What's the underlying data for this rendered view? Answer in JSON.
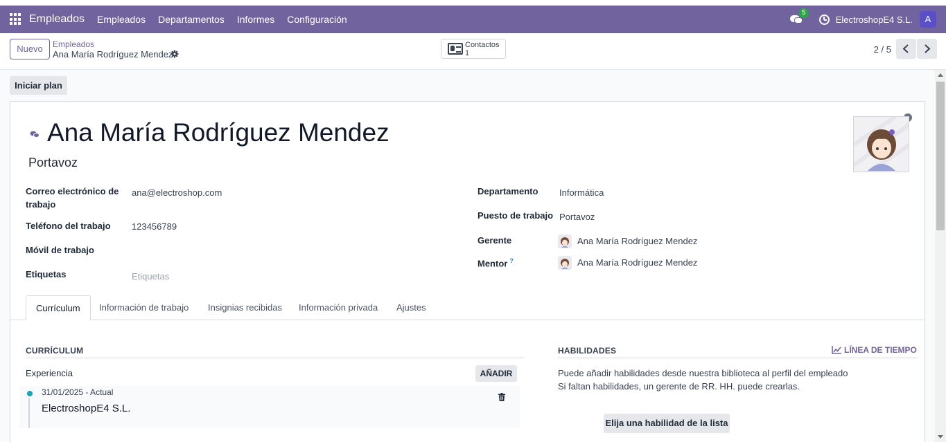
{
  "navbar": {
    "app_name": "Empleados",
    "menu": [
      "Empleados",
      "Departamentos",
      "Informes",
      "Configuración"
    ],
    "chat_badge": "5",
    "company": "ElectroshopE4 S.L.",
    "user_initial": "A",
    "color": "#71639e"
  },
  "control": {
    "new_button": "Nuevo",
    "breadcrumb_parent": "Empleados",
    "breadcrumb_current": "Ana María Rodríguez Mendez",
    "smart_button_label": "Contactos",
    "smart_button_count": "1",
    "pager": "2 / 5"
  },
  "actions": {
    "start_plan": "Iniciar plan"
  },
  "employee": {
    "name": "Ana María Rodríguez Mendez",
    "job_title": "Portavoz",
    "status_color": "#6b7280"
  },
  "fields_left": [
    {
      "label": "Correo electrónico de trabajo",
      "value": "ana@electroshop.com"
    },
    {
      "label": "Teléfono del trabajo",
      "value": "123456789"
    },
    {
      "label": "Móvil de trabajo",
      "value": ""
    },
    {
      "label": "Etiquetas",
      "placeholder": "Etiquetas"
    }
  ],
  "fields_right": [
    {
      "label": "Departamento",
      "value": "Informática"
    },
    {
      "label": "Puesto de trabajo",
      "value": "Portavoz"
    },
    {
      "label": "Gerente",
      "value": "Ana María Rodríguez Mendez"
    },
    {
      "label": "Mentor",
      "help": "?",
      "value": "Ana María Rodríguez Mendez"
    }
  ],
  "tabs": [
    "Currículum",
    "Información de trabajo",
    "Insignias recibidas",
    "Información privada",
    "Ajustes"
  ],
  "resume": {
    "section_title": "CURRÍCULUM",
    "group": "Experiencia",
    "add_button": "AÑADIR",
    "lines": [
      {
        "date": "31/01/2025 - Actual",
        "name": "ElectroshopE4 S.L."
      }
    ]
  },
  "skills": {
    "section_title": "HABILIDADES",
    "timeline_button": "LÍNEA DE TIEMPO",
    "help_line1": "Puede añadir habilidades desde nuestra biblioteca al perfil del empleado",
    "help_line2": "Si faltan habilidades, un gerente de RR. HH. puede crearlas.",
    "pick_button": "Elija una habilidad de la lista"
  }
}
